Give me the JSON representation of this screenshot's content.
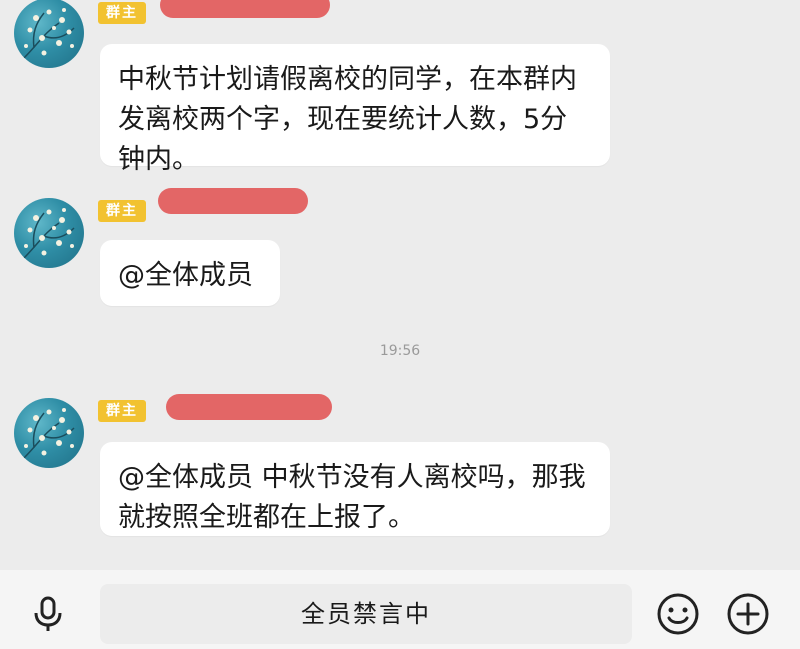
{
  "chat": {
    "messages": [
      {
        "role": "群主",
        "text": "中秋节计划请假离校的同学，在本群内发离校两个字，现在要统计人数，5分钟内。"
      },
      {
        "role": "群主",
        "text": "@全体成员"
      },
      {
        "role": "群主",
        "text": "@全体成员 中秋节没有人离校吗，那我就按照全班都在上报了。"
      }
    ],
    "timestamp": "19:56"
  },
  "input_bar": {
    "muted_label": "全员禁言中",
    "icons": [
      "microphone-icon",
      "emoji-icon",
      "plus-icon"
    ]
  },
  "colors": {
    "background": "#ececec",
    "bubble": "#ffffff",
    "role_badge": "#f2c230",
    "redaction": "#e25a5a"
  }
}
